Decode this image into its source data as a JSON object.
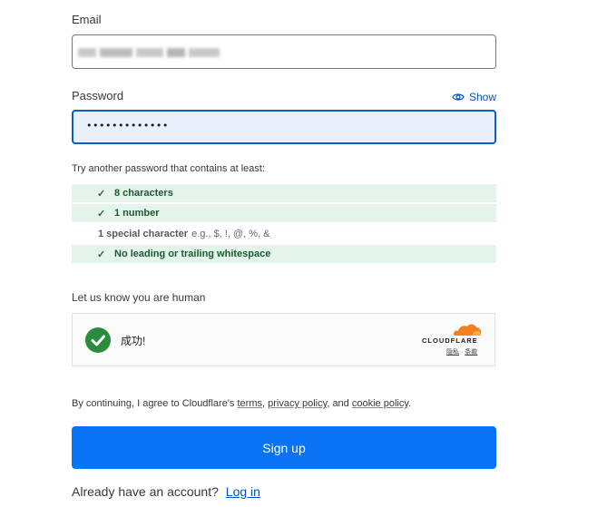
{
  "email": {
    "label": "Email",
    "value": ""
  },
  "password": {
    "label": "Password",
    "value": "•••••••••••••",
    "show_label": "Show"
  },
  "requirements": {
    "title": "Try another password that contains at least:",
    "items": [
      {
        "text": "8 characters",
        "met": true
      },
      {
        "text": "1 number",
        "met": true
      },
      {
        "text": "1 special character",
        "example": "e.g., $, !, @, %, &",
        "met": false
      },
      {
        "text": "No leading or trailing whitespace",
        "met": true
      }
    ]
  },
  "human_check": {
    "label": "Let us know you are human",
    "status": "成功!",
    "provider": "CLOUDFLARE",
    "privacy_link": "隐私",
    "separator": "·",
    "terms_link": "条款"
  },
  "agreement": {
    "prefix": "By continuing, I agree to Cloudflare's ",
    "terms": "terms",
    "sep1": ", ",
    "privacy": "privacy policy",
    "sep2": ", and ",
    "cookie": "cookie policy",
    "suffix": "."
  },
  "signup_button": "Sign up",
  "login_prompt": {
    "text": "Already have an account?",
    "link": "Log in"
  },
  "colors": {
    "primary": "#0a73f5",
    "success": "#2b8c3e",
    "link": "#0051c3",
    "cf_orange": "#f38020"
  }
}
